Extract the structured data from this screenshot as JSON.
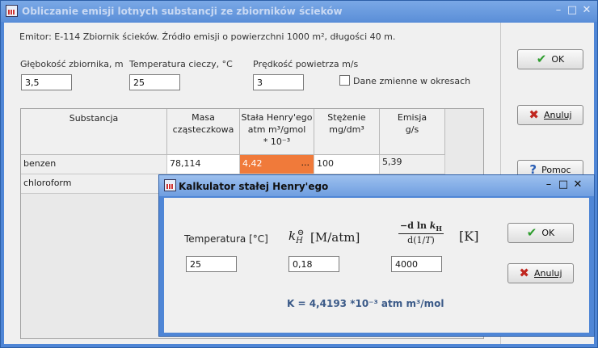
{
  "main": {
    "title": "Obliczanie emisji lotnych substancji ze zbiorników ścieków",
    "emitor": "Emitor: E-114 Zbiornik ścieków. Źródło emisji o powierzchni 1000 m², długości 40 m.",
    "depth_label": "Głębokość zbiornika, m",
    "depth_value": "3,5",
    "temp_label": "Temperatura cieczy, °C",
    "temp_value": "25",
    "wind_label": "Prędkość powietrza  m/s",
    "wind_value": "3",
    "variable_label": "Dane zmienne  w okresach",
    "grid_headers": {
      "substance": "Substancja",
      "mass_1": "Masa",
      "mass_2": "cząsteczkowa",
      "henry_1": "Stała Henry'ego",
      "henry_2": "atm m³/gmol",
      "henry_3": "* 10⁻³",
      "conc_1": "Stężenie",
      "conc_2": "mg/dm³",
      "emis_1": "Emisja",
      "emis_2": "g/s"
    },
    "rows": [
      {
        "substance": "benzen",
        "mass": "78,114",
        "henry": "4,42",
        "ellipsis": "...",
        "conc": "100",
        "emission": "5,39"
      },
      {
        "substance": "chloroform"
      }
    ],
    "ok_label": "OK",
    "cancel_label": "Anuluj",
    "help_label": "Pomoc"
  },
  "dialog": {
    "title": "Kalkulator stałej Henry'ego",
    "temp_label": "Temperatura  [°C]",
    "kh_label": "[M/atm]",
    "k_unit": "[K]",
    "temp_value": "25",
    "kh_value": "0,18",
    "dk_value": "4000",
    "result": "K = 4,4193 *10⁻³ atm m³/mol",
    "ok_label": "OK",
    "cancel_label": "Anuluj"
  },
  "colors": {
    "henry_cell": "#f07a3a",
    "ok_check": "#2e9d2e",
    "cancel_x": "#c0261f",
    "help_q": "#2b5fb5"
  }
}
